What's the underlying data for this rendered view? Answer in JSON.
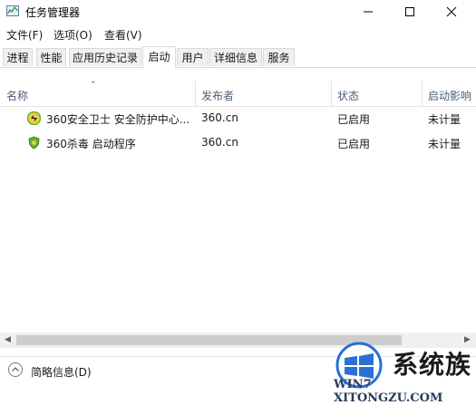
{
  "window": {
    "title": "任务管理器"
  },
  "menu": [
    "文件(F)",
    "选项(O)",
    "查看(V)"
  ],
  "tabs": [
    {
      "label": "进程"
    },
    {
      "label": "性能"
    },
    {
      "label": "应用历史记录"
    },
    {
      "label": "启动",
      "active": true
    },
    {
      "label": "用户"
    },
    {
      "label": "详细信息"
    },
    {
      "label": "服务"
    }
  ],
  "columns": [
    "名称",
    "发布者",
    "状态",
    "启动影响"
  ],
  "rows": [
    {
      "icon": "360-safeguard-icon",
      "name": "360安全卫士 安全防护中心...",
      "publisher": "360.cn",
      "status": "已启用",
      "impact": "未计量"
    },
    {
      "icon": "360-antivirus-shield-icon",
      "name": "360杀毒 启动程序",
      "publisher": "360.cn",
      "status": "已启用",
      "impact": "未计量"
    }
  ],
  "footer": {
    "fewer_details": "简略信息(D)"
  },
  "watermark": {
    "brand": "系统族",
    "url": "WIN7 XITONGZU.COM"
  },
  "colors": {
    "header_text": "#4c607a",
    "tab_bg": "#f0f0f0",
    "accent_green": "#5ab52a"
  }
}
